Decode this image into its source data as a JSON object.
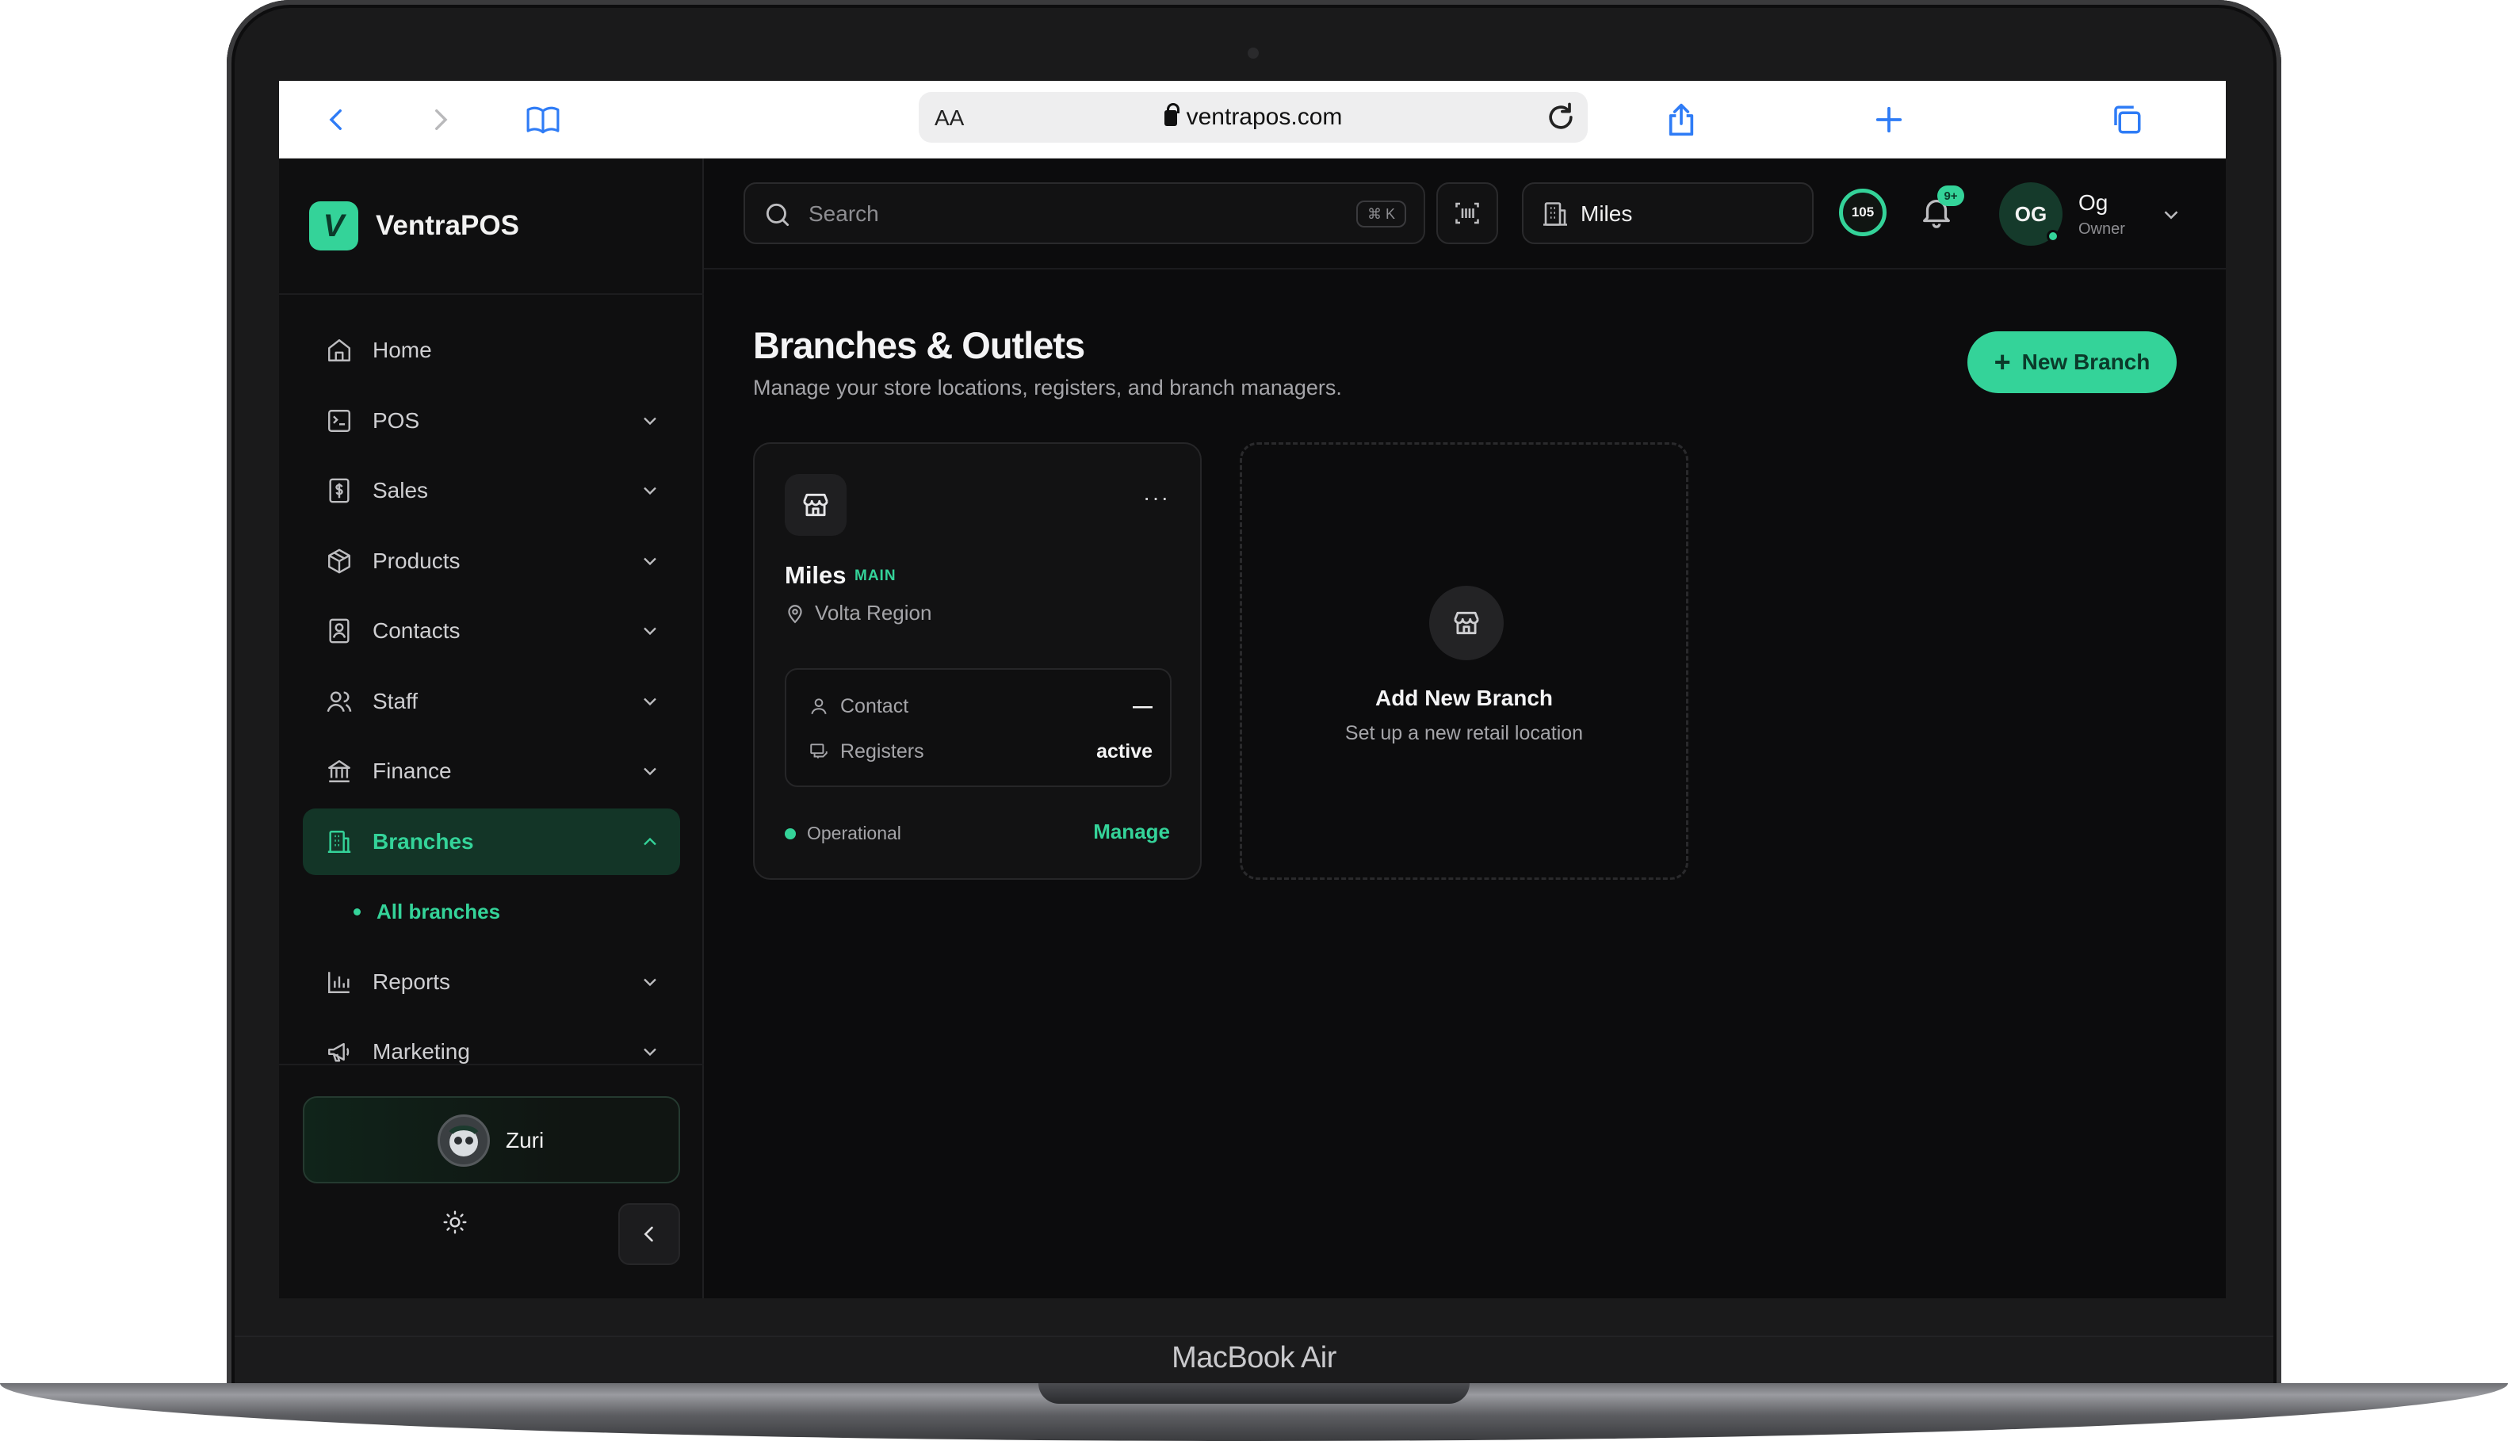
{
  "browser": {
    "url": "ventrapos.com",
    "reader_label": "AA"
  },
  "device_label": "MacBook Air",
  "brand": {
    "logo_letter": "V",
    "name": "VentraPOS"
  },
  "sidebar": {
    "items": [
      {
        "label": "Home",
        "icon": "home-icon",
        "has_children": false
      },
      {
        "label": "POS",
        "icon": "terminal-icon",
        "has_children": true
      },
      {
        "label": "Sales",
        "icon": "receipt-dollar-icon",
        "has_children": true
      },
      {
        "label": "Products",
        "icon": "box-icon",
        "has_children": true
      },
      {
        "label": "Contacts",
        "icon": "contact-card-icon",
        "has_children": true
      },
      {
        "label": "Staff",
        "icon": "users-icon",
        "has_children": true
      },
      {
        "label": "Finance",
        "icon": "bank-icon",
        "has_children": true
      },
      {
        "label": "Branches",
        "icon": "building-icon",
        "has_children": true,
        "active": true,
        "children": [
          {
            "label": "All branches",
            "active": true
          }
        ]
      },
      {
        "label": "Reports",
        "icon": "bar-chart-icon",
        "has_children": true
      },
      {
        "label": "Marketing",
        "icon": "megaphone-icon",
        "has_children": true
      }
    ],
    "profile": {
      "name": "Zuri"
    }
  },
  "topbar": {
    "search": {
      "placeholder": "Search",
      "shortcut": "⌘ K"
    },
    "branch_selector": "Miles",
    "credits": "105",
    "notifications_badge": "9+",
    "user": {
      "initials": "OG",
      "name": "Og",
      "role": "Owner",
      "online": true
    }
  },
  "main": {
    "title": "Branches & Outlets",
    "subtitle": "Manage your store locations, registers, and branch managers.",
    "new_button": "New Branch",
    "branch_card": {
      "name": "Miles",
      "tag": "MAIN",
      "location": "Volta Region",
      "more": "···",
      "contact_label": "Contact",
      "contact_value": "—",
      "registers_label": "Registers",
      "registers_value": "active",
      "status": "Operational",
      "manage": "Manage"
    },
    "add_card": {
      "title": "Add New Branch",
      "subtitle": "Set up a new retail location"
    }
  },
  "colors": {
    "accent": "#34d399",
    "background": "#0c0c0d",
    "active_bg": "#133527"
  }
}
